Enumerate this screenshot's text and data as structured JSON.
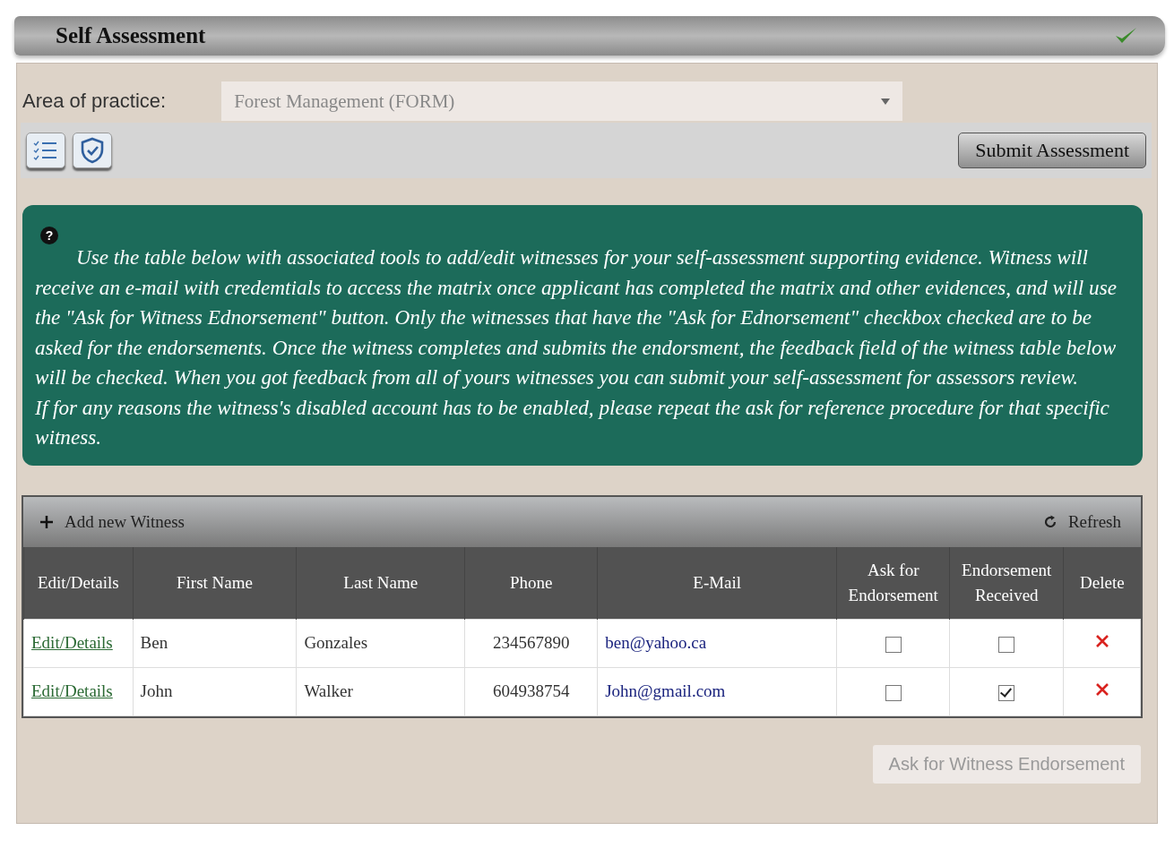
{
  "header": {
    "title": "Self Assessment",
    "complete": true
  },
  "area": {
    "label": "Area of practice:",
    "value": "Forest Management (FORM)"
  },
  "toolbar": {
    "submit": "Submit Assessment"
  },
  "info": {
    "icon": "?",
    "paragraphs": [
      "Use the table below with associated tools to add/edit witnesses for your self-assessment supporting evidence. Witness will receive an e-mail with credemtials to access the matrix once applicant has completed the matrix and other evidences, and will use the \"Ask for Witness Ednorsement\" button. Only the witnesses that have the \"Ask for Ednorsement\" checkbox checked are to be asked for the endorsements. Once the witness completes and submits the endorsment, the feedback field of the witness table below will be checked. When you got feedback from all of yours witnesses you can submit your self-assessment for assessors review.",
      "If for any reasons the witness's disabled account has to be enabled, please repeat the ask for reference procedure for that specific witness."
    ]
  },
  "table": {
    "add": "Add new Witness",
    "refresh": "Refresh",
    "columns": [
      "Edit/Details",
      "First Name",
      "Last Name",
      "Phone",
      "E-Mail",
      "Ask for Endorsement",
      "Endorsement Received",
      "Delete"
    ],
    "rows": [
      {
        "edit": "Edit/Details",
        "first_name": "Ben",
        "last_name": "Gonzales",
        "phone": "234567890",
        "email": "ben@yahoo.ca",
        "ask_endorsement": false,
        "endorsement_received": false
      },
      {
        "edit": "Edit/Details",
        "first_name": "John",
        "last_name": "Walker",
        "phone": "604938754",
        "email": "John@gmail.com",
        "ask_endorsement": false,
        "endorsement_received": true
      }
    ]
  },
  "ask_button": {
    "label": "Ask for Witness Endorsement",
    "disabled": true
  }
}
